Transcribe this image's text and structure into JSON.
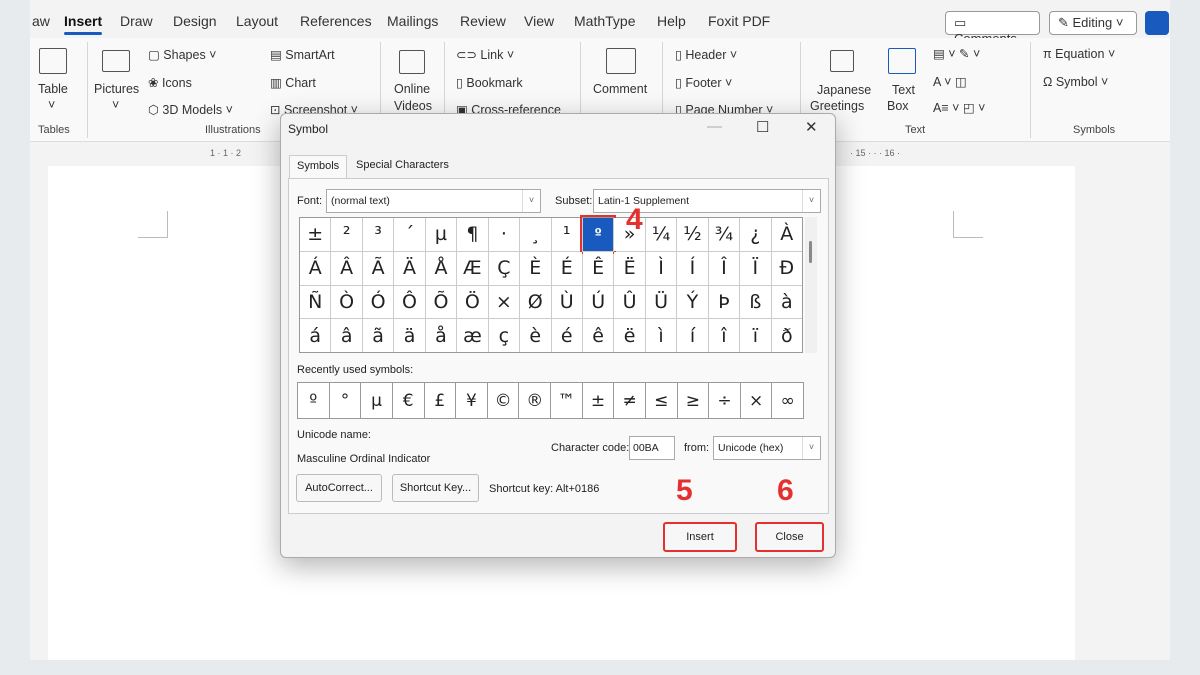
{
  "ribbon": {
    "tabs": [
      "aw",
      "Insert",
      "Draw",
      "Design",
      "Layout",
      "References",
      "Mailings",
      "Review",
      "View",
      "MathType",
      "Help",
      "Foxit PDF"
    ],
    "active_tab": "Insert",
    "comments": "Comments",
    "editing": "Editing",
    "tables": {
      "table": "Table",
      "group": "Tables"
    },
    "illustrations": {
      "pictures": "Pictures",
      "shapes": "Shapes",
      "icons": "Icons",
      "models": "3D Models",
      "smartart": "SmartArt",
      "chart": "Chart",
      "screenshot": "Screenshot",
      "group": "Illustrations"
    },
    "media": {
      "online_videos_1": "Online",
      "online_videos_2": "Videos"
    },
    "links": {
      "link": "Link",
      "bookmark": "Bookmark",
      "crossref": "Cross-reference"
    },
    "comments_group": {
      "comment": "Comment"
    },
    "header_footer": {
      "header": "Header",
      "footer": "Footer",
      "page_number": "Page Number"
    },
    "text": {
      "japanese_1": "Japanese",
      "japanese_2": "Greetings",
      "textbox_1": "Text",
      "textbox_2": "Box",
      "group": "Text"
    },
    "symbols": {
      "equation": "Equation",
      "symbol": "Symbol",
      "group": "Symbols"
    }
  },
  "ruler": {
    "left_marks": "1 · 1 · 2",
    "right_marks": "· 15 · · · 16 ·"
  },
  "dialog": {
    "title": "Symbol",
    "tabs": [
      "Symbols",
      "Special Characters"
    ],
    "font_label": "Font:",
    "font_value": "(normal text)",
    "subset_label": "Subset:",
    "subset_value": "Latin-1 Supplement",
    "symbols": [
      "±",
      "²",
      "³",
      "´",
      "µ",
      "¶",
      "·",
      "¸",
      "¹",
      "º",
      "»",
      "¼",
      "½",
      "¾",
      "¿",
      "À",
      "Á",
      "Â",
      "Ã",
      "Ä",
      "Å",
      "Æ",
      "Ç",
      "È",
      "É",
      "Ê",
      "Ë",
      "Ì",
      "Í",
      "Î",
      "Ï",
      "Ð",
      "Ñ",
      "Ò",
      "Ó",
      "Ô",
      "Õ",
      "Ö",
      "×",
      "Ø",
      "Ù",
      "Ú",
      "Û",
      "Ü",
      "Ý",
      "Þ",
      "ß",
      "à",
      "á",
      "â",
      "ã",
      "ä",
      "å",
      "æ",
      "ç",
      "è",
      "é",
      "ê",
      "ë",
      "ì",
      "í",
      "î",
      "ï",
      "ð"
    ],
    "selected_symbol": "º",
    "recent_label": "Recently used symbols:",
    "recent": [
      "º",
      "°",
      "µ",
      "€",
      "£",
      "¥",
      "©",
      "®",
      "™",
      "±",
      "≠",
      "≤",
      "≥",
      "÷",
      "×",
      "∞"
    ],
    "unicode_name_label": "Unicode name:",
    "unicode_name": "Masculine Ordinal Indicator",
    "char_code_label": "Character code:",
    "char_code": "00BA",
    "from_label": "from:",
    "from_value": "Unicode (hex)",
    "autocorrect": "AutoCorrect...",
    "shortcut_key_btn": "Shortcut Key...",
    "shortcut_key_text": "Shortcut key: Alt+0186",
    "insert": "Insert",
    "close": "Close"
  },
  "callouts": {
    "step4": "4",
    "step5": "5",
    "step6": "6"
  },
  "colors": {
    "accent": "#185abd",
    "highlight": "#e53030"
  }
}
